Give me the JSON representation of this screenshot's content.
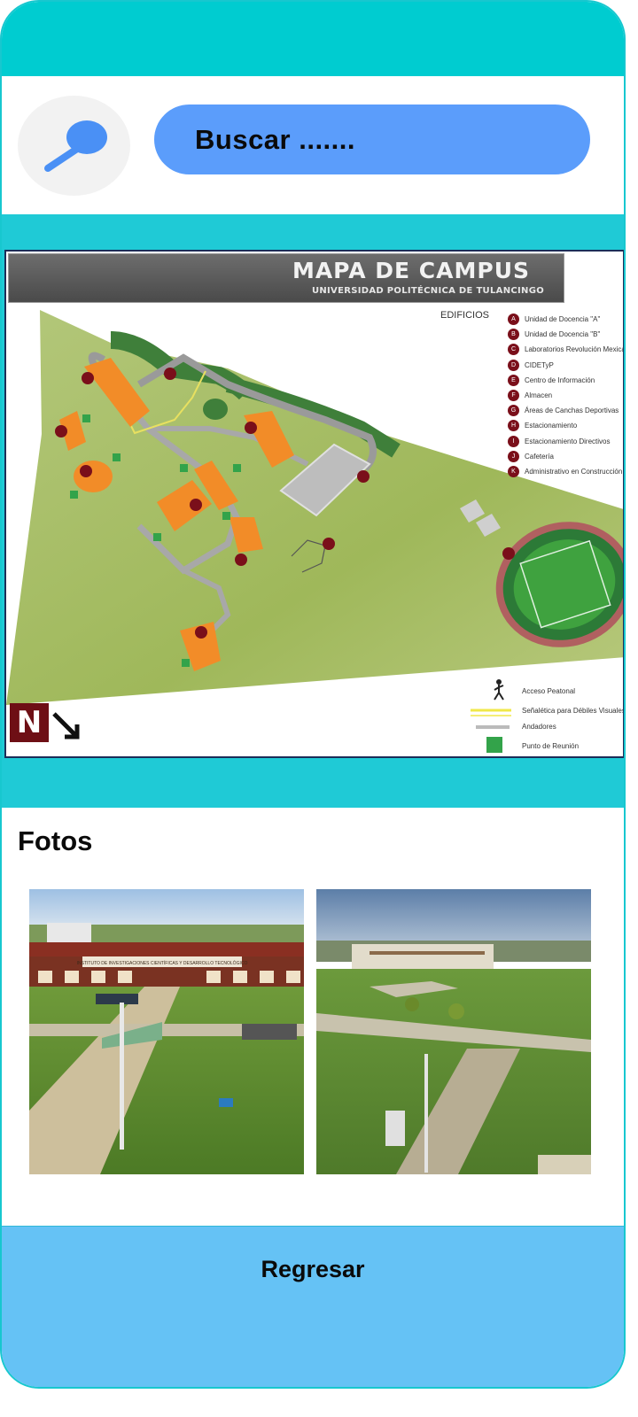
{
  "search": {
    "placeholder": "Buscar ......."
  },
  "map": {
    "title": "MAPA DE CAMPUS",
    "subtitle": "UNIVERSIDAD POLITÉCNICA DE TULANCINGO",
    "legend_heading": "EDIFICIOS",
    "buildings": [
      {
        "code": "A",
        "label": "Unidad de Docencia \"A\""
      },
      {
        "code": "B",
        "label": "Unidad de Docencia \"B\""
      },
      {
        "code": "C",
        "label": "Laboratorios Revolución Mexicana"
      },
      {
        "code": "D",
        "label": "CIDETyP"
      },
      {
        "code": "E",
        "label": "Centro de Información"
      },
      {
        "code": "F",
        "label": "Almacen"
      },
      {
        "code": "G",
        "label": "Áreas de Canchas Deportivas"
      },
      {
        "code": "H",
        "label": "Estacionamiento"
      },
      {
        "code": "I",
        "label": "Estacionamiento Directivos"
      },
      {
        "code": "J",
        "label": "Cafetería"
      },
      {
        "code": "K",
        "label": "Administrativo en Construcción"
      }
    ],
    "symbols": [
      {
        "label": "Acceso Peatonal"
      },
      {
        "label": "Señalética para Débiles Visuales"
      },
      {
        "label": "Andadores"
      },
      {
        "label": "Punto de Reunión"
      }
    ],
    "north_label": "N"
  },
  "photos": {
    "title": "Fotos",
    "building_sign": "INSTITUTO DE INVESTIGACIONES CIENTÍFICAS Y DESARROLLO TECNOLÓGICO"
  },
  "footer": {
    "back_label": "Regresar"
  },
  "colors": {
    "top_bar": "#00ccd0",
    "map_band": "#1fcad6",
    "search_field": "#5b9dfb",
    "footer": "#65c2f5"
  },
  "icons": {
    "search": "magnifier-icon",
    "north": "north-arrow-icon"
  }
}
